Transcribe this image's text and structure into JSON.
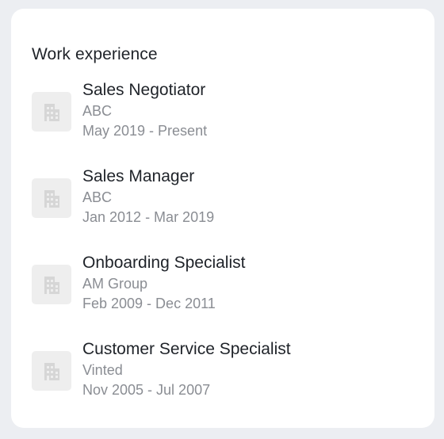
{
  "section": {
    "title": "Work experience"
  },
  "experience": [
    {
      "role": "Sales Negotiator",
      "company": "ABC",
      "dates": "May 2019 - Present",
      "icon": "building-icon"
    },
    {
      "role": "Sales Manager",
      "company": "ABC",
      "dates": "Jan 2012 - Mar 2019",
      "icon": "building-icon"
    },
    {
      "role": "Onboarding Specialist",
      "company": "AM Group",
      "dates": "Feb 2009 - Dec 2011",
      "icon": "building-icon"
    },
    {
      "role": "Customer Service Specialist",
      "company": "Vinted",
      "dates": "Nov 2005 - Jul 2007",
      "icon": "building-icon"
    }
  ],
  "colors": {
    "background": "#eceef2",
    "card": "#ffffff",
    "primary_text": "#1f2329",
    "secondary_text": "#8a8d93",
    "logo_bg": "#eeeeee",
    "logo_icon": "#d6d6d6"
  }
}
